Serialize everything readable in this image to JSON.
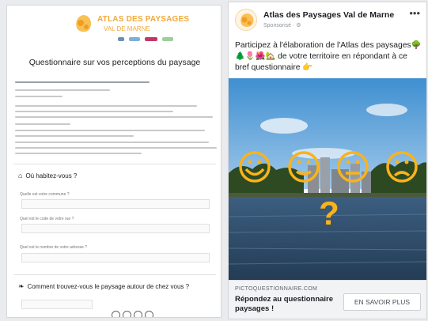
{
  "questionnaire": {
    "brand_line1": "ATLAS DES PAYSAGES",
    "brand_line2": "VAL DE MARNE",
    "title": "Questionnaire sur vos perceptions du paysage",
    "q1": "Où habitez-vous ?",
    "q2": "Comment trouvez-vous le paysage autour de chez vous ?",
    "field_label_1": "Quelle est votre commune ?",
    "field_label_2": "Quel est le code de votre rue ?",
    "field_label_3": "Quel est le nombre de votre adresse ?"
  },
  "ad": {
    "page_name": "Atlas des Paysages Val de Marne",
    "sponsored": "Sponsorisé · ⚙",
    "more_icon": "more-options-icon",
    "text": "Participez à l'élaboration de l'Atlas des paysages🌳🌲🌷🌺🏡 de votre territoire en répondant à ce bref questionnaire 👉",
    "domain": "PICTOQUESTIONNAIRE.COM",
    "cta_title": "Répondez au questionnaire paysages !",
    "cta_button": "EN SAVOIR PLUS"
  },
  "colors": {
    "brand_orange": "#f2a93b",
    "emoji_yellow": "#f9b31b"
  }
}
